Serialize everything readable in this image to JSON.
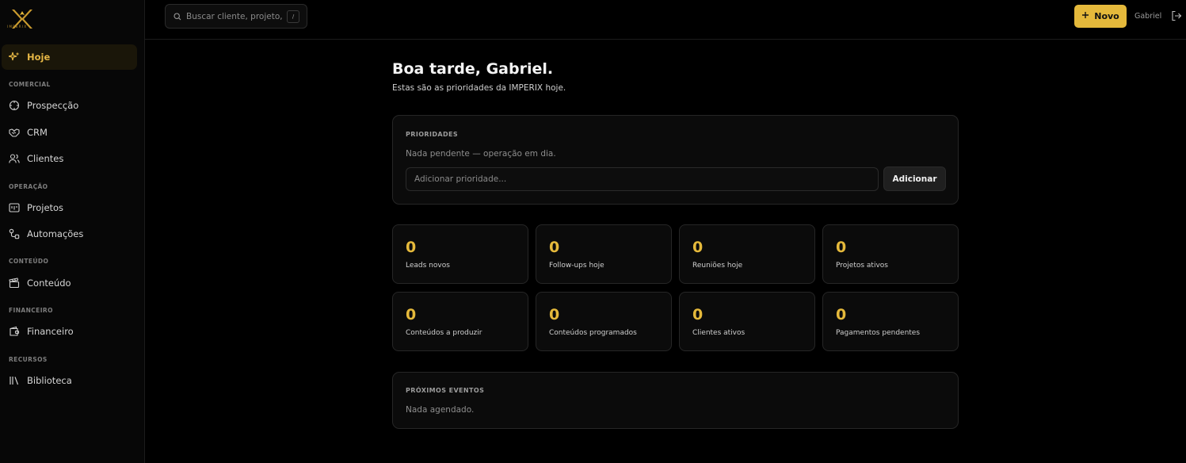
{
  "brand": {
    "logo_text": "IMPERIX",
    "accent": "#e5b93b"
  },
  "sidebar": {
    "items": [
      {
        "key": "hoje",
        "label": "Hoje",
        "icon": "sparkle-icon",
        "active": true
      },
      {
        "key": "prospeccao",
        "label": "Prospecção",
        "icon": "crosshair-icon"
      },
      {
        "key": "crm",
        "label": "CRM",
        "icon": "handshake-icon"
      },
      {
        "key": "clientes",
        "label": "Clientes",
        "icon": "users-icon"
      },
      {
        "key": "projetos",
        "label": "Projetos",
        "icon": "kanban-icon"
      },
      {
        "key": "automacoes",
        "label": "Automações",
        "icon": "workflow-icon"
      },
      {
        "key": "conteudo",
        "label": "Conteúdo",
        "icon": "clapperboard-icon"
      },
      {
        "key": "financeiro",
        "label": "Financeiro",
        "icon": "wallet-icon"
      },
      {
        "key": "biblioteca",
        "label": "Biblioteca",
        "icon": "library-icon"
      }
    ],
    "sections": {
      "comercial": "COMERCIAL",
      "operacao": "OPERAÇÃO",
      "conteudo": "CONTEÚDO",
      "financeiro": "FINANCEIRO",
      "recursos": "RECURSOS"
    }
  },
  "topbar": {
    "search_placeholder": "Buscar cliente, projeto,",
    "search_shortcut": "/",
    "new_button": "Novo",
    "user_name": "Gabriel"
  },
  "main": {
    "greeting": "Boa tarde, Gabriel.",
    "subtitle": "Estas são as prioridades da IMPERIX hoje.",
    "priorities": {
      "title": "PRIORIDADES",
      "empty_text": "Nada pendente — operação em dia.",
      "input_placeholder": "Adicionar prioridade...",
      "add_button": "Adicionar"
    },
    "stats": [
      {
        "value": "0",
        "label": "Leads novos"
      },
      {
        "value": "0",
        "label": "Follow-ups hoje"
      },
      {
        "value": "0",
        "label": "Reuniões hoje"
      },
      {
        "value": "0",
        "label": "Projetos ativos"
      },
      {
        "value": "0",
        "label": "Conteúdos a produzir"
      },
      {
        "value": "0",
        "label": "Conteúdos programados"
      },
      {
        "value": "0",
        "label": "Clientes ativos"
      },
      {
        "value": "0",
        "label": "Pagamentos pendentes"
      }
    ],
    "events": {
      "title": "PRÓXIMOS EVENTOS",
      "empty_text": "Nada agendado."
    }
  }
}
